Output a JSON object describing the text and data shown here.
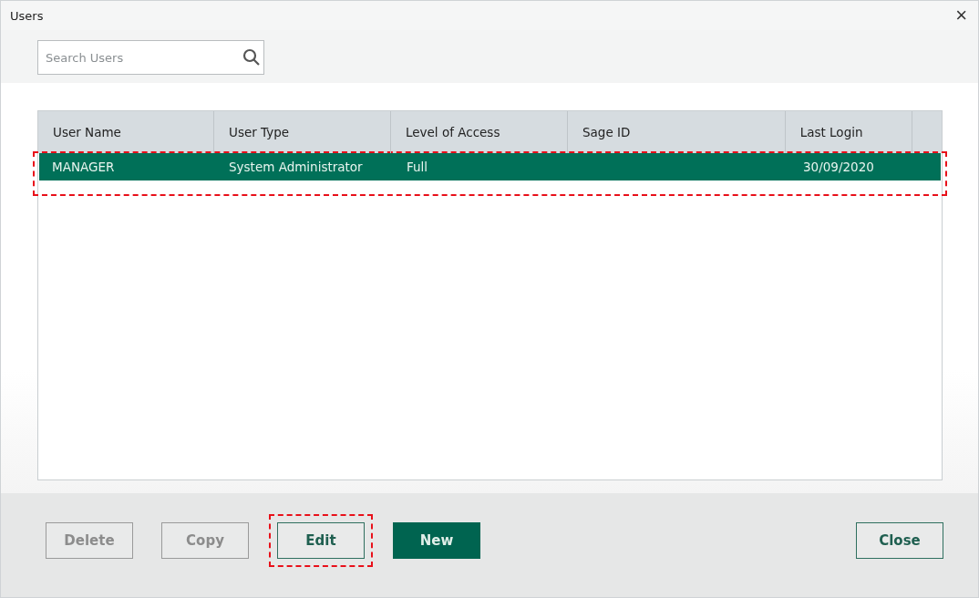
{
  "window": {
    "title": "Users",
    "close": "×"
  },
  "search": {
    "placeholder": "Search Users"
  },
  "table": {
    "columns": [
      "User Name",
      "User Type",
      "Level of Access",
      "Sage ID",
      "Last Login"
    ],
    "rows": [
      {
        "cells": [
          "MANAGER",
          "System Administrator",
          "Full",
          "",
          "30/09/2020"
        ],
        "selected": true,
        "highlighted": true
      }
    ]
  },
  "buttons": [
    {
      "label": "Delete",
      "kind": "secondary",
      "disabled": true,
      "highlighted": false
    },
    {
      "label": "Copy",
      "kind": "secondary",
      "disabled": true,
      "highlighted": false
    },
    {
      "label": "Edit",
      "kind": "secondary",
      "disabled": false,
      "highlighted": true
    },
    {
      "label": "New",
      "kind": "primary",
      "disabled": false,
      "highlighted": false
    }
  ],
  "close_button": {
    "label": "Close",
    "kind": "secondary",
    "disabled": false
  }
}
